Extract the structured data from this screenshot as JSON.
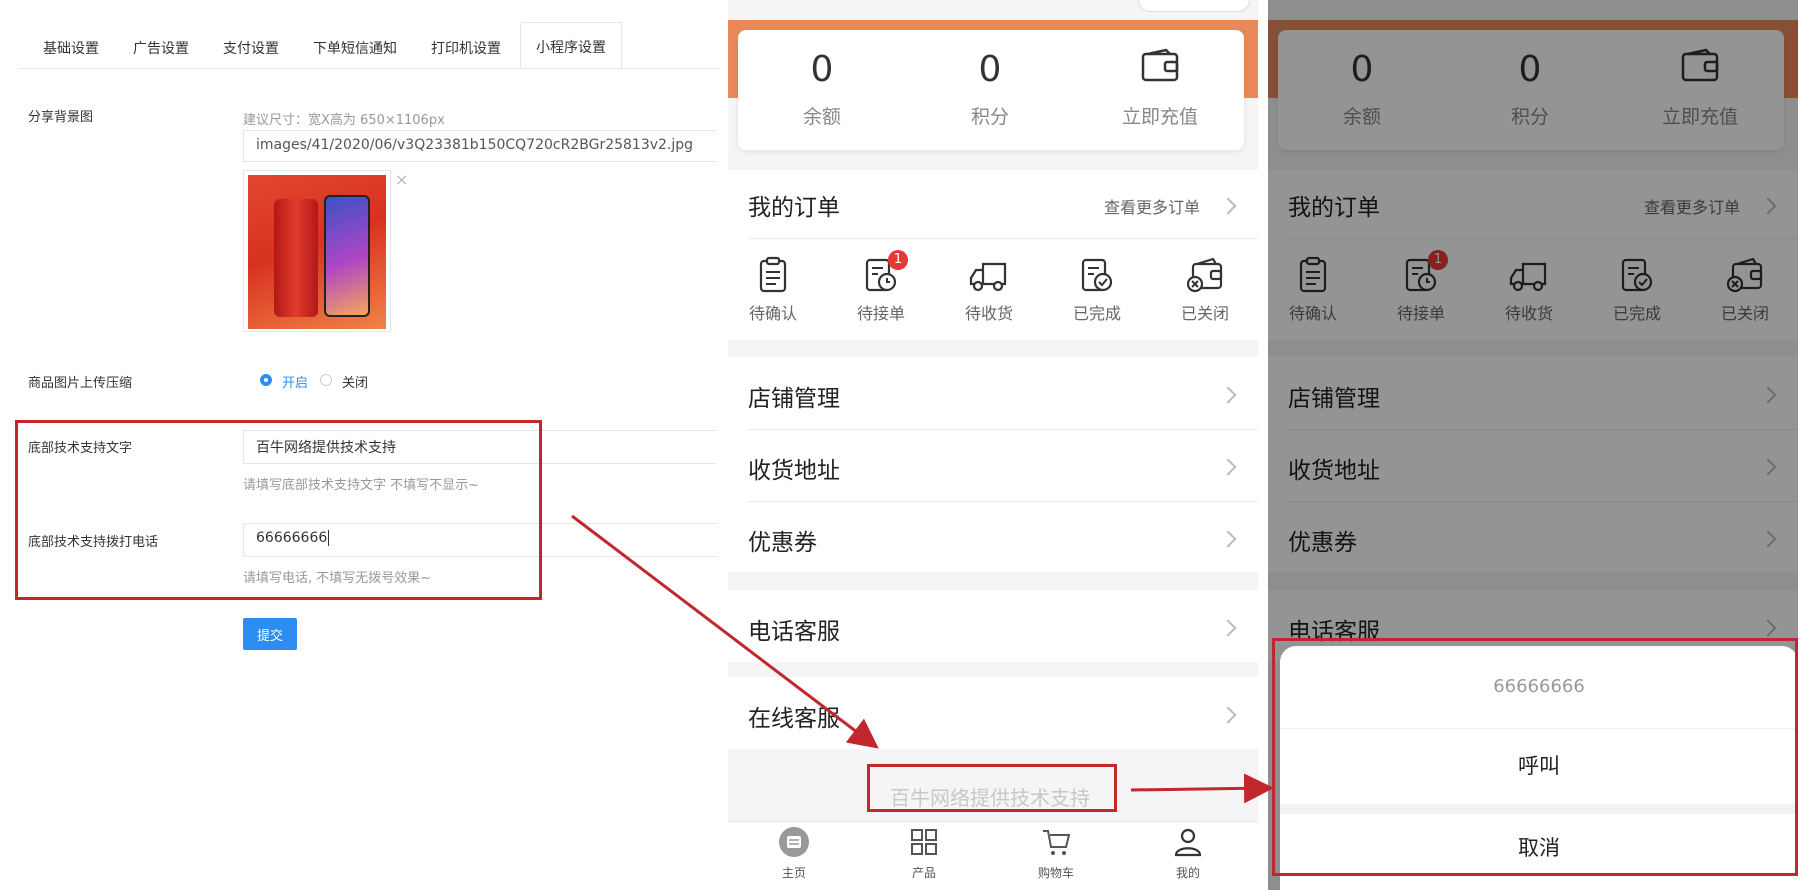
{
  "admin": {
    "tabs": [
      "基础设置",
      "广告设置",
      "支付设置",
      "下单短信通知",
      "打印机设置",
      "小程序设置"
    ],
    "share_bg": {
      "label": "分享背景图",
      "size_hint": "建议尺寸：宽X高为 650×1106px",
      "path": "images/41/2020/06/v3Q23381b150CQ720cR2BGr25813v2.jpg",
      "remove": "×"
    },
    "compress": {
      "label": "商品图片上传压缩",
      "on": "开启",
      "off": "关闭",
      "selected": "开启"
    },
    "support_text": {
      "label": "底部技术支持文字",
      "value": "百牛网络提供技术支持",
      "hint": "请填写底部技术支持文字 不填写不显示~"
    },
    "support_phone": {
      "label": "底部技术支持拨打电话",
      "value": "66666666",
      "hint": "请填写电话, 不填写无拨号效果~"
    },
    "submit": "提交"
  },
  "phone": {
    "stats": [
      {
        "value": "0",
        "label": "余额"
      },
      {
        "value": "0",
        "label": "积分"
      },
      {
        "label": "立即充值"
      }
    ],
    "orders": {
      "title": "我的订单",
      "more": "查看更多订单",
      "items": [
        {
          "label": "待确认"
        },
        {
          "label": "待接单",
          "badge": "1"
        },
        {
          "label": "待收货"
        },
        {
          "label": "已完成"
        },
        {
          "label": "已关闭"
        }
      ]
    },
    "menu": [
      "店铺管理",
      "收货地址",
      "优惠券",
      "电话客服",
      "在线客服"
    ],
    "footer": "百牛网络提供技术支持",
    "tabbar": [
      "主页",
      "产品",
      "购物车",
      "我的"
    ],
    "sheet": {
      "number": "66666666",
      "call": "呼叫",
      "cancel": "取消"
    }
  },
  "colors": {
    "accent": "#2d8cf0",
    "annotation_red": "#c1272d",
    "header_orange": "#e9895b",
    "badge_red": "#e53935"
  }
}
